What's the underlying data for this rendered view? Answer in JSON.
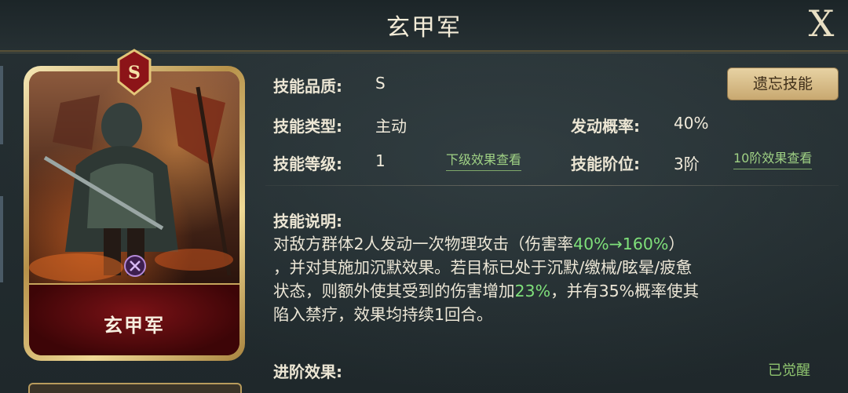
{
  "header": {
    "title": "玄甲军",
    "close_label": "X"
  },
  "card": {
    "name": "玄甲军",
    "rank": "S"
  },
  "skill": {
    "quality_label": "技能品质:",
    "quality_value": "S",
    "type_label": "技能类型:",
    "type_value": "主动",
    "level_label": "技能等级:",
    "level_value": "1",
    "next_effect_link": "下级效果查看",
    "trigger_label": "发动概率:",
    "trigger_value": "40%",
    "tier_label": "技能阶位:",
    "tier_value": "3阶",
    "tier10_link": "10阶效果查看",
    "forget_button": "遗忘技能",
    "desc_label": "技能说明:",
    "desc_parts": {
      "p1": "对敌方群体2人发动一次物理攻击（伤害率",
      "p1_hl": "40%→160%",
      "p1_end": "）",
      "p2": "，并对其施加沉默效果。若目标已处于沉默/缴械/眩晕/疲惫",
      "p3a": "状态，则额外使其受到的伤害增加",
      "p3_hl": "23%",
      "p3b": "，并有35%概率使其",
      "p4": "陷入禁疗，效果均持续1回合。"
    },
    "advance_label": "进阶效果:",
    "awakened": "已觉醒"
  },
  "colors": {
    "highlight": "#7fe07a",
    "link": "#9fd184",
    "gold": "#c8a870"
  },
  "icons": {
    "close": "close-icon",
    "rank": "rank-s-badge-icon",
    "type": "skill-type-icon"
  }
}
